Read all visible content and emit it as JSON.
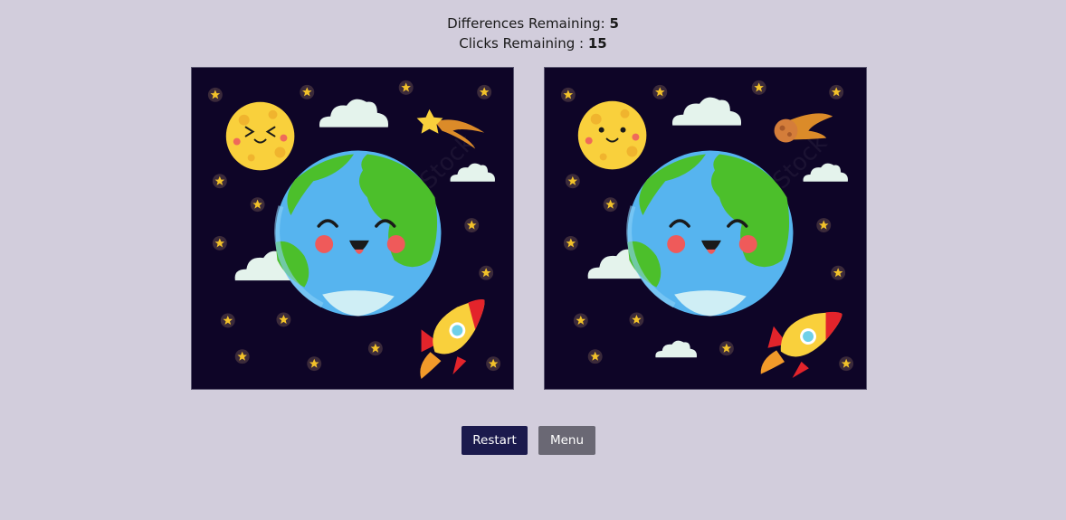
{
  "status": {
    "differences_label": "Differences Remaining: ",
    "differences_value": "5",
    "clicks_label": "Clicks Remaining : ",
    "clicks_value": "15"
  },
  "buttons": {
    "restart": "Restart",
    "menu": "Menu"
  },
  "watermark": "Adobe Stock",
  "panels": [
    {
      "name": "left-image",
      "scene": [
        "moon-squinting-face",
        "shooting-star",
        "earth-smiling-face",
        "clouds",
        "rocket",
        "stars"
      ]
    },
    {
      "name": "right-image",
      "scene": [
        "moon-open-eyes-face",
        "comet",
        "earth-smiling-face",
        "clouds",
        "rocket",
        "stars"
      ]
    }
  ],
  "colors": {
    "background": "#d2cddc",
    "space": "#0e0527",
    "restart_button": "#1b1a4d",
    "menu_button": "#6a6874",
    "moon": "#f9d03c",
    "ocean": "#4aaee9",
    "land": "#4cbf2b"
  }
}
